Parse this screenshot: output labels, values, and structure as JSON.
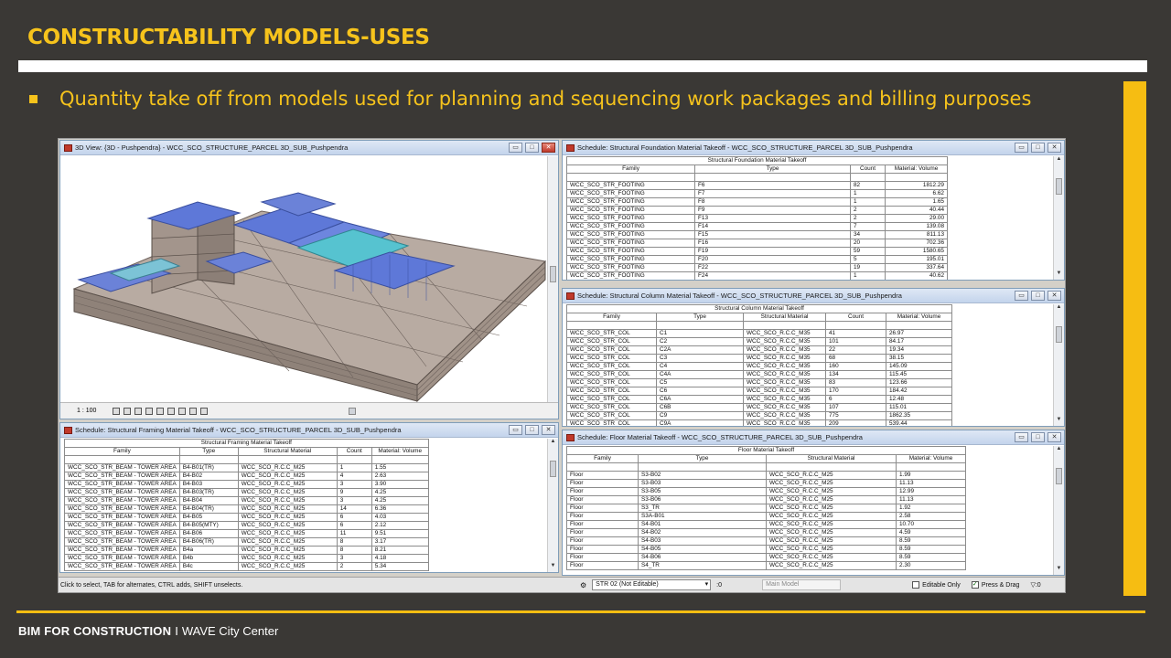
{
  "slide": {
    "title": "CONSTRUCTABILITY MODELS-USES",
    "bullet": "Quantity take off from models used for planning and sequencing work packages and billing purposes",
    "footer_bold": "BIM FOR CONSTRUCTION",
    "footer_sep": "I",
    "footer_light": "WAVE City Center"
  },
  "window_buttons": {
    "minimize": "▭",
    "restore": "□",
    "close": "✕"
  },
  "view3d": {
    "title": "3D View: {3D - Pushpendra} - WCC_SCO_STRUCTURE_PARCEL 3D_SUB_Pushpendra",
    "scale": "1 : 100"
  },
  "foundation": {
    "title": "Schedule: Structural Foundation Material Takeoff - WCC_SCO_STRUCTURE_PARCEL 3D_SUB_Pushpendra",
    "heading": "Structural Foundation Material Takeoff",
    "columns": [
      "Family",
      "Type",
      "Count",
      "Material: Volume"
    ],
    "rows": [
      [
        "WCC_SCO_STR_FOOTING",
        "F6",
        "82",
        "1812.29"
      ],
      [
        "WCC_SCO_STR_FOOTING",
        "F7",
        "1",
        "6.62"
      ],
      [
        "WCC_SCO_STR_FOOTING",
        "F8",
        "1",
        "1.65"
      ],
      [
        "WCC_SCO_STR_FOOTING",
        "F9",
        "2",
        "40.44"
      ],
      [
        "WCC_SCO_STR_FOOTING",
        "F13",
        "2",
        "29.00"
      ],
      [
        "WCC_SCO_STR_FOOTING",
        "F14",
        "7",
        "139.08"
      ],
      [
        "WCC_SCO_STR_FOOTING",
        "F15",
        "34",
        "811.13"
      ],
      [
        "WCC_SCO_STR_FOOTING",
        "F16",
        "20",
        "702.36"
      ],
      [
        "WCC_SCO_STR_FOOTING",
        "F19",
        "59",
        "1580.65"
      ],
      [
        "WCC_SCO_STR_FOOTING",
        "F20",
        "5",
        "195.01"
      ],
      [
        "WCC_SCO_STR_FOOTING",
        "F22",
        "19",
        "337.64"
      ],
      [
        "WCC_SCO_STR_FOOTING",
        "F24",
        "1",
        "40.62"
      ]
    ]
  },
  "column": {
    "title": "Schedule: Structural Column Material Takeoff - WCC_SCO_STRUCTURE_PARCEL 3D_SUB_Pushpendra",
    "heading": "Structural Column Material Takeoff",
    "columns": [
      "Family",
      "Type",
      "Structural Material",
      "Count",
      "Material: Volume"
    ],
    "rows": [
      [
        "WCC_SCO_STR_COL",
        "C1",
        "WCC_SCO_R.C.C_M35",
        "41",
        "26.97"
      ],
      [
        "WCC_SCO_STR_COL",
        "C2",
        "WCC_SCO_R.C.C_M35",
        "101",
        "84.17"
      ],
      [
        "WCC_SCO_STR_COL",
        "C2A",
        "WCC_SCO_R.C.C_M35",
        "22",
        "19.34"
      ],
      [
        "WCC_SCO_STR_COL",
        "C3",
        "WCC_SCO_R.C.C_M35",
        "68",
        "38.15"
      ],
      [
        "WCC_SCO_STR_COL",
        "C4",
        "WCC_SCO_R.C.C_M35",
        "160",
        "145.09"
      ],
      [
        "WCC_SCO_STR_COL",
        "C4A",
        "WCC_SCO_R.C.C_M35",
        "134",
        "115.45"
      ],
      [
        "WCC_SCO_STR_COL",
        "C5",
        "WCC_SCO_R.C.C_M35",
        "83",
        "123.66"
      ],
      [
        "WCC_SCO_STR_COL",
        "C6",
        "WCC_SCO_R.C.C_M35",
        "170",
        "184.42"
      ],
      [
        "WCC_SCO_STR_COL",
        "C6A",
        "WCC_SCO_R.C.C_M35",
        "6",
        "12.48"
      ],
      [
        "WCC_SCO_STR_COL",
        "C6B",
        "WCC_SCO_R.C.C_M35",
        "107",
        "115.01"
      ],
      [
        "WCC_SCO_STR_COL",
        "C9",
        "WCC_SCO_R.C.C_M35",
        "775",
        "1862.35"
      ],
      [
        "WCC_SCO_STR_COL",
        "C9A",
        "WCC_SCO_R.C.C_M35",
        "209",
        "539.44"
      ]
    ]
  },
  "framing": {
    "title": "Schedule: Structural Framing Material Takeoff - WCC_SCO_STRUCTURE_PARCEL 3D_SUB_Pushpendra",
    "heading": "Structural Framing Material Takeoff",
    "columns": [
      "Family",
      "Type",
      "Structural Material",
      "Count",
      "Material: Volume"
    ],
    "rows": [
      [
        "WCC_SCO_STR_BEAM - TOWER AREA",
        "B4-B01(TR)",
        "WCC_SCO_R.C.C_M25",
        "1",
        "1.55"
      ],
      [
        "WCC_SCO_STR_BEAM - TOWER AREA",
        "B4-B02",
        "WCC_SCO_R.C.C_M25",
        "4",
        "2.63"
      ],
      [
        "WCC_SCO_STR_BEAM - TOWER AREA",
        "B4-B03",
        "WCC_SCO_R.C.C_M25",
        "3",
        "3.90"
      ],
      [
        "WCC_SCO_STR_BEAM - TOWER AREA",
        "B4-B03(TR)",
        "WCC_SCO_R.C.C_M25",
        "9",
        "4.25"
      ],
      [
        "WCC_SCO_STR_BEAM - TOWER AREA",
        "B4-B04",
        "WCC_SCO_R.C.C_M25",
        "3",
        "4.25"
      ],
      [
        "WCC_SCO_STR_BEAM - TOWER AREA",
        "B4-B04(TR)",
        "WCC_SCO_R.C.C_M25",
        "14",
        "6.36"
      ],
      [
        "WCC_SCO_STR_BEAM - TOWER AREA",
        "B4-B05",
        "WCC_SCO_R.C.C_M25",
        "6",
        "4.03"
      ],
      [
        "WCC_SCO_STR_BEAM - TOWER AREA",
        "B4-B05(MTY)",
        "WCC_SCO_R.C.C_M25",
        "6",
        "2.12"
      ],
      [
        "WCC_SCO_STR_BEAM - TOWER AREA",
        "B4-B06",
        "WCC_SCO_R.C.C_M25",
        "11",
        "9.51"
      ],
      [
        "WCC_SCO_STR_BEAM - TOWER AREA",
        "B4-B06(TR)",
        "WCC_SCO_R.C.C_M25",
        "8",
        "3.17"
      ],
      [
        "WCC_SCO_STR_BEAM - TOWER AREA",
        "B4a",
        "WCC_SCO_R.C.C_M25",
        "8",
        "8.21"
      ],
      [
        "WCC_SCO_STR_BEAM - TOWER AREA",
        "B4b",
        "WCC_SCO_R.C.C_M25",
        "3",
        "4.18"
      ],
      [
        "WCC_SCO_STR_BEAM - TOWER AREA",
        "B4c",
        "WCC_SCO_R.C.C_M25",
        "2",
        "5.34"
      ]
    ]
  },
  "floor": {
    "title": "Schedule: Floor Material Takeoff - WCC_SCO_STRUCTURE_PARCEL 3D_SUB_Pushpendra",
    "heading": "Floor Material Takeoff",
    "columns": [
      "Family",
      "Type",
      "Structural Material",
      "Material: Volume"
    ],
    "rows": [
      [
        "Floor",
        "S3-B02",
        "WCC_SCO_R.C.C_M25",
        "1.99"
      ],
      [
        "Floor",
        "S3-B03",
        "WCC_SCO_R.C.C_M25",
        "11.13"
      ],
      [
        "Floor",
        "S3-B05",
        "WCC_SCO_R.C.C_M25",
        "12.99"
      ],
      [
        "Floor",
        "S3-B06",
        "WCC_SCO_R.C.C_M25",
        "11.13"
      ],
      [
        "Floor",
        "S3_TR",
        "WCC_SCO_R.C.C_M25",
        "1.92"
      ],
      [
        "Floor",
        "S3A-B01",
        "WCC_SCO_R.C.C_M25",
        "2.58"
      ],
      [
        "Floor",
        "S4-B01",
        "WCC_SCO_R.C.C_M25",
        "10.70"
      ],
      [
        "Floor",
        "S4-B02",
        "WCC_SCO_R.C.C_M25",
        "4.59"
      ],
      [
        "Floor",
        "S4-B03",
        "WCC_SCO_R.C.C_M25",
        "8.59"
      ],
      [
        "Floor",
        "S4-B05",
        "WCC_SCO_R.C.C_M25",
        "8.59"
      ],
      [
        "Floor",
        "S4-B06",
        "WCC_SCO_R.C.C_M25",
        "8.59"
      ],
      [
        "Floor",
        "S4_TR",
        "WCC_SCO_R.C.C_M25",
        "2.30"
      ]
    ]
  },
  "statusbar": {
    "hint": "Click to select, TAB for alternates, CTRL adds, SHIFT unselects.",
    "view": "STR 02 (Not Editable)",
    "zero": ":0",
    "model": "Main Model",
    "editable_only": "Editable Only",
    "press_drag": "Press & Drag",
    "filter": ":0"
  },
  "colors": {
    "accent": "#f6bd12",
    "background": "#3a3835",
    "title_text": "#f6c31c"
  }
}
